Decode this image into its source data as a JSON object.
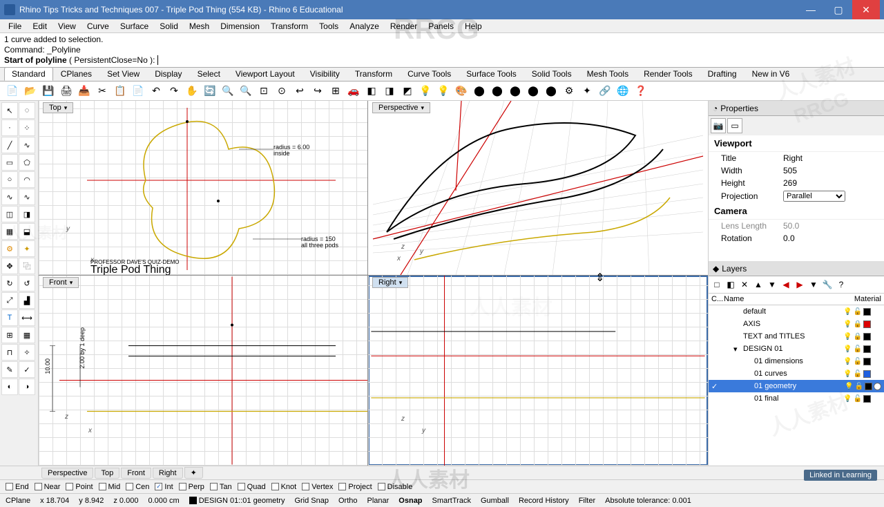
{
  "titlebar": {
    "title": "Rhino Tips Tricks and Techniques 007 - Triple Pod Thing (554 KB) - Rhino 6 Educational"
  },
  "menubar": [
    "File",
    "Edit",
    "View",
    "Curve",
    "Surface",
    "Solid",
    "Mesh",
    "Dimension",
    "Transform",
    "Tools",
    "Analyze",
    "Render",
    "Panels",
    "Help"
  ],
  "command": {
    "line1": "1 curve added to selection.",
    "line2": "Command: _Polyline",
    "prompt": "Start of polyline",
    "options": "( PersistentClose=No ):"
  },
  "tabs": [
    "Standard",
    "CPlanes",
    "Set View",
    "Display",
    "Select",
    "Viewport Layout",
    "Visibility",
    "Transform",
    "Curve Tools",
    "Surface Tools",
    "Solid Tools",
    "Mesh Tools",
    "Render Tools",
    "Drafting",
    "New in V6"
  ],
  "viewport_labels": {
    "top": "Top",
    "perspective": "Perspective",
    "front": "Front",
    "right": "Right"
  },
  "top_annot": {
    "radius1": "radius = 6.00",
    "inside": "inside",
    "radius2": "radius = 150",
    "allpods": "all three pods",
    "prof": "PROFESSOR DAVE'S QUIZ-DEMO",
    "name": "Triple Pod Thing"
  },
  "front_annot": {
    "dim1": "2.00 by 1 deep",
    "dim2": "10.00"
  },
  "properties": {
    "title": "Properties",
    "section1": "Viewport",
    "rows": [
      {
        "label": "Title",
        "value": "Right"
      },
      {
        "label": "Width",
        "value": "505"
      },
      {
        "label": "Height",
        "value": "269"
      },
      {
        "label": "Projection",
        "value": "Parallel"
      }
    ],
    "section2": "Camera",
    "rows2": [
      {
        "label": "Lens Length",
        "value": "50.0"
      },
      {
        "label": "Rotation",
        "value": "0.0"
      }
    ]
  },
  "layers": {
    "title": "Layers",
    "cols": {
      "c": "C...",
      "name": "Name",
      "mat": "Material"
    },
    "items": [
      {
        "name": "default",
        "indent": 0,
        "color": "#000"
      },
      {
        "name": "AXIS",
        "indent": 0,
        "color": "#d00",
        "locked": true
      },
      {
        "name": "TEXT and TITLES",
        "indent": 0,
        "color": "#000",
        "locked": true
      },
      {
        "name": "DESIGN 01",
        "indent": 0,
        "color": "#000",
        "expand": true
      },
      {
        "name": "01 dimensions",
        "indent": 1,
        "color": "#000"
      },
      {
        "name": "01 curves",
        "indent": 1,
        "color": "#2060e0"
      },
      {
        "name": "01 geometry",
        "indent": 1,
        "color": "#000",
        "sel": true,
        "current": true,
        "matwhite": true
      },
      {
        "name": "01 final",
        "indent": 1,
        "color": "#000"
      }
    ]
  },
  "bottom_tabs": [
    "Perspective",
    "Top",
    "Front",
    "Right"
  ],
  "osnaps": [
    {
      "label": "End",
      "checked": false
    },
    {
      "label": "Near",
      "checked": false
    },
    {
      "label": "Point",
      "checked": false
    },
    {
      "label": "Mid",
      "checked": false
    },
    {
      "label": "Cen",
      "checked": false
    },
    {
      "label": "Int",
      "checked": true
    },
    {
      "label": "Perp",
      "checked": false
    },
    {
      "label": "Tan",
      "checked": false
    },
    {
      "label": "Quad",
      "checked": false
    },
    {
      "label": "Knot",
      "checked": false
    },
    {
      "label": "Vertex",
      "checked": false
    },
    {
      "label": "Project",
      "checked": false
    },
    {
      "label": "Disable",
      "checked": false,
      "special": true
    }
  ],
  "status": {
    "cplane": "CPlane",
    "x": "x 18.704",
    "y": "y 8.942",
    "z": "z 0.000",
    "units": "0.000 cm",
    "layer": "DESIGN 01::01 geometry",
    "toggles": [
      "Grid Snap",
      "Ortho",
      "Planar",
      "Osnap",
      "SmartTrack",
      "Gumball",
      "Record History",
      "Filter"
    ],
    "tol": "Absolute tolerance: 0.001"
  },
  "watermarks": {
    "rrcg": "RRCG",
    "cn": "人人素材"
  },
  "linkedin": "Linked in Learning"
}
